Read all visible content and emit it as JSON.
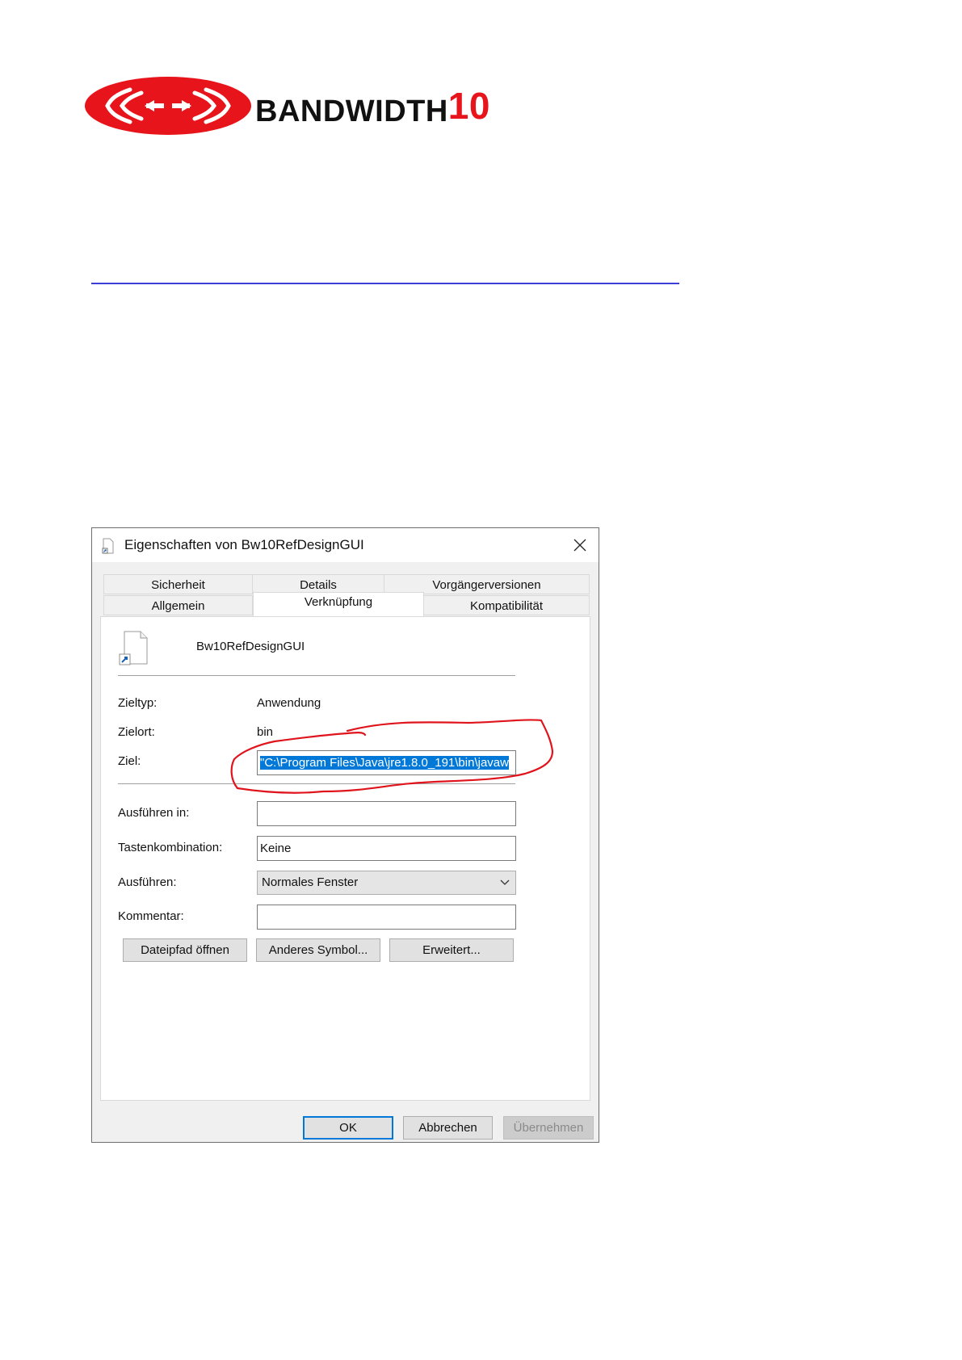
{
  "logo": {
    "brand": "BANDWIDTH",
    "number": "10"
  },
  "dialog": {
    "title": "Eigenschaften von Bw10RefDesignGUI",
    "tabs_top": [
      "Sicherheit",
      "Details",
      "Vorgängerversionen"
    ],
    "tabs_bottom": [
      "Allgemein",
      "Verknüpfung",
      "Kompatibilität"
    ],
    "active_tab": "Verknüpfung",
    "shortcut_name": "Bw10RefDesignGUI",
    "fields": {
      "zieltyp_label": "Zieltyp:",
      "zieltyp_value": "Anwendung",
      "zielort_label": "Zielort:",
      "zielort_value": "bin",
      "ziel_label": "Ziel:",
      "ziel_value": "\"C:\\Program Files\\Java\\jre1.8.0_191\\bin\\javaw",
      "ausfuehren_in_label": "Ausführen in:",
      "ausfuehren_in_value": "",
      "tastenkombination_label": "Tastenkombination:",
      "tastenkombination_value": "Keine",
      "ausfuehren_label": "Ausführen:",
      "ausfuehren_value": "Normales Fenster",
      "kommentar_label": "Kommentar:",
      "kommentar_value": ""
    },
    "buttons": {
      "open_path": "Dateipfad öffnen",
      "change_icon": "Anderes Symbol...",
      "advanced": "Erweitert...",
      "ok": "OK",
      "cancel": "Abbrechen",
      "apply": "Übernehmen"
    }
  },
  "colors": {
    "brand_red": "#e8141b",
    "highlight_circle": "#e0141c",
    "selection": "#0078d7",
    "rule_blue": "#3b3fd6"
  },
  "icons": [
    "logo-emblem-icon",
    "shortcut-file-icon",
    "close-icon",
    "chevron-down-icon"
  ]
}
